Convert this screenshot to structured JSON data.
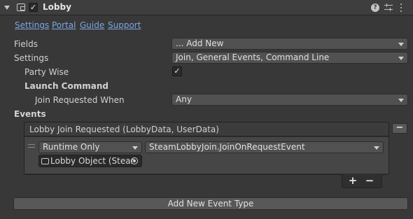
{
  "header": {
    "title": "Lobby",
    "enabled": true,
    "help_glyph": "?"
  },
  "links": [
    "Settings",
    "Portal",
    "Guide",
    "Support"
  ],
  "fields": {
    "fields_label": "Fields",
    "fields_value": "... Add New",
    "settings_label": "Settings",
    "settings_value": "Join, General Events, Command Line",
    "party_wise_label": "Party Wise",
    "party_wise_checked": true,
    "launch_command_label": "Launch Command",
    "join_requested_label": "Join Requested When",
    "join_requested_value": "Any"
  },
  "events": {
    "label": "Events",
    "event_title": "Lobby Join Requested (LobbyData, UserData)",
    "listener": {
      "mode": "Runtime Only",
      "function": "SteamLobbyJoin.JoinOnRequestEvent",
      "object": "Lobby Object (Stear"
    },
    "remove_glyph": "−",
    "add_listener_glyph": "+",
    "remove_listener_glyph": "−",
    "add_event_type_label": "Add New Event Type"
  },
  "icons": [
    "foldout-arrow-icon",
    "component-icon",
    "help-icon",
    "preset-icon",
    "kebab-menu-icon",
    "object-icon",
    "object-picker-icon",
    "drag-handle-icon"
  ],
  "colors": {
    "background": "#383838",
    "header": "#3e3e3e",
    "link": "#7ca6e2",
    "dropdown": "#515151",
    "button": "#585858"
  }
}
